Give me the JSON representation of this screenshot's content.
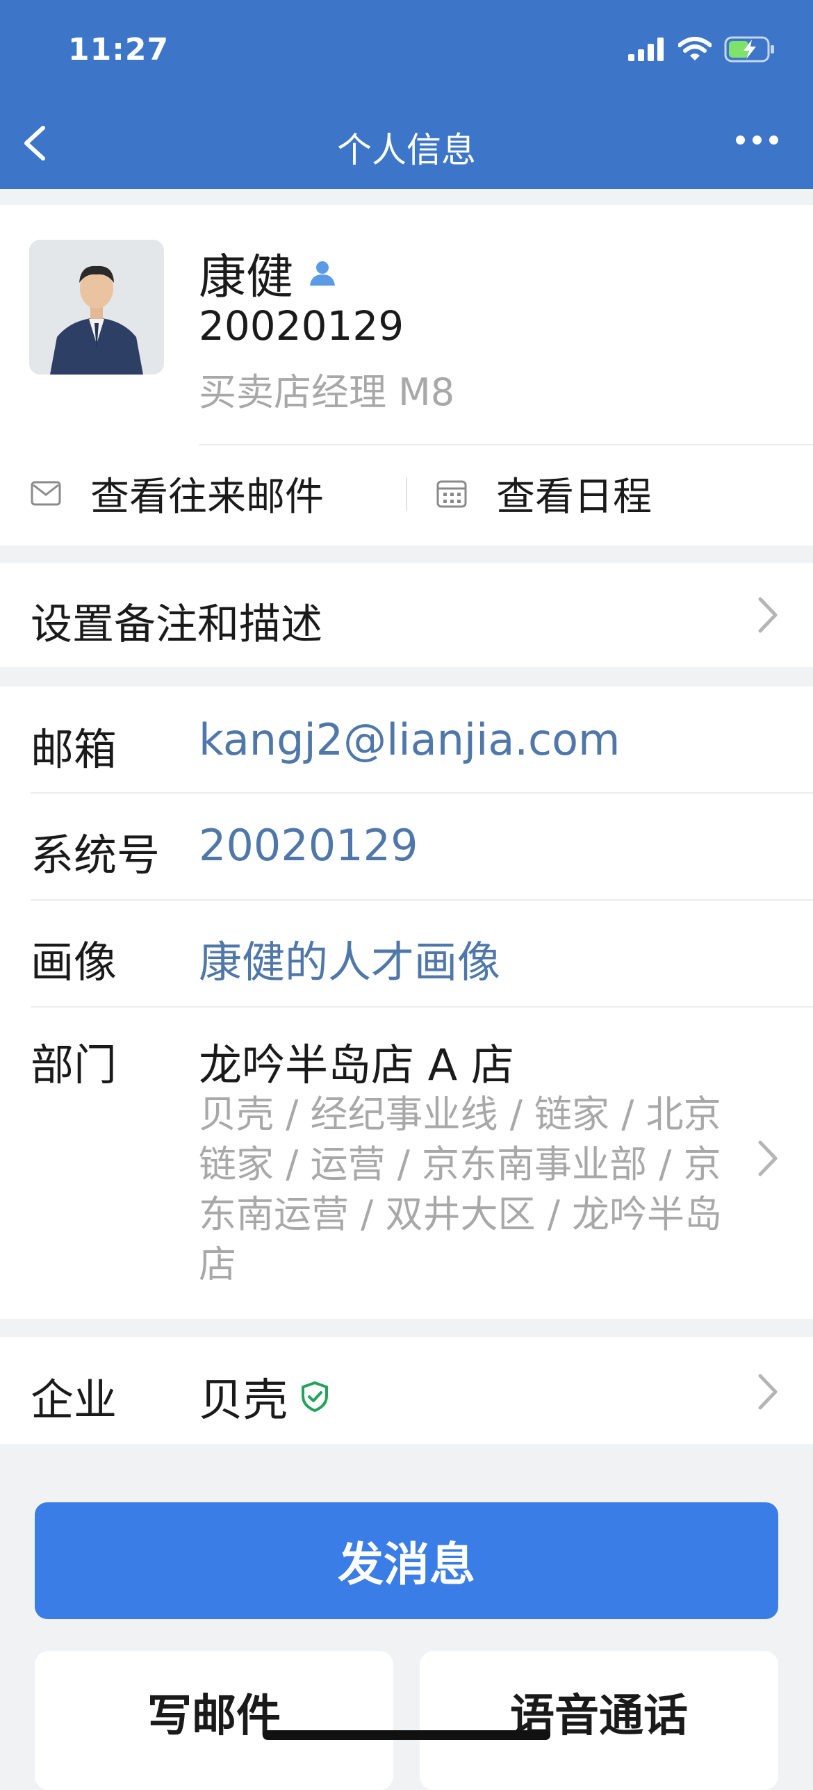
{
  "status_bar": {
    "time": "11:27"
  },
  "nav": {
    "title": "个人信息"
  },
  "profile": {
    "name": "康健",
    "id": "20020129",
    "title": "买卖店经理 M8"
  },
  "actions": {
    "mail_label": "查看往来邮件",
    "schedule_label": "查看日程"
  },
  "remark": {
    "label": "设置备注和描述"
  },
  "info": {
    "email": {
      "label": "邮箱",
      "value": "kangj2@lianjia.com"
    },
    "system_id": {
      "label": "系统号",
      "value": "20020129"
    },
    "portrait": {
      "label": "画像",
      "value": "康健的人才画像"
    },
    "department": {
      "label": "部门",
      "name": "龙吟半岛店 A 店",
      "path": "贝壳 / 经纪事业线 / 链家 / 北京链家 / 运营 / 京东南事业部 / 京东南运营 / 双井大区 / 龙吟半岛店"
    }
  },
  "company": {
    "label": "企业",
    "value": "贝壳"
  },
  "buttons": {
    "send_message": "发消息",
    "write_mail": "写邮件",
    "voice_call": "语音通话"
  },
  "colors": {
    "header_bg": "#3d76c8",
    "primary_button": "#3a7de6",
    "link_text": "#4f77aa",
    "verified_green": "#22a35a"
  }
}
